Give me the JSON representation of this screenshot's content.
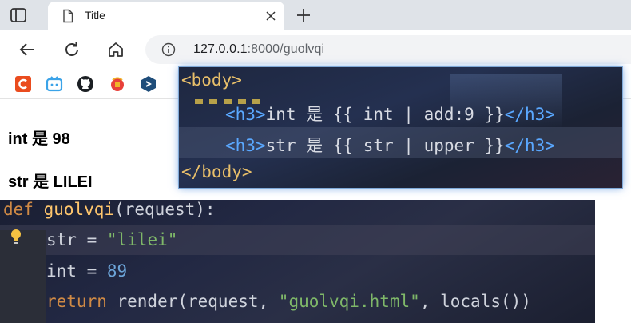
{
  "tab": {
    "title": "Title"
  },
  "address_bar": {
    "host": "127.0.0.1",
    "rest": ":8000/guolvqi"
  },
  "content": {
    "line1": "int 是 98",
    "line2": "str 是 LILEI"
  },
  "html_code": {
    "line1": "<body>",
    "line2_open": "<h3>",
    "line2_mid": "int 是 {{ int | add:9 }}",
    "line2_close": "</h3>",
    "line3_open": "<h3>",
    "line3_mid": "str 是 {{ str | upper }}",
    "line3_close": "</h3>",
    "line4": "</body>"
  },
  "py_code": {
    "kw_def": "def",
    "fn_name": "guolvqi",
    "sig_rest": "(request):",
    "var_str": "str",
    "assign_eq": " = ",
    "str_val": "\"lilei\"",
    "var_int": "int",
    "num_val": "89",
    "kw_return": "return",
    "call_start": " render(request, ",
    "str_file": "\"guolvqi.html\"",
    "call_end": ", locals())"
  },
  "colors": {
    "accent_bookmark_c": "#ea4c1e",
    "accent_bookmark_tv": "#3ba3e8"
  },
  "icons": [
    "tab-actions-icon",
    "page-icon",
    "close-icon",
    "plus-icon",
    "back-icon",
    "reload-icon",
    "home-icon",
    "info-icon",
    "bulb-icon"
  ]
}
